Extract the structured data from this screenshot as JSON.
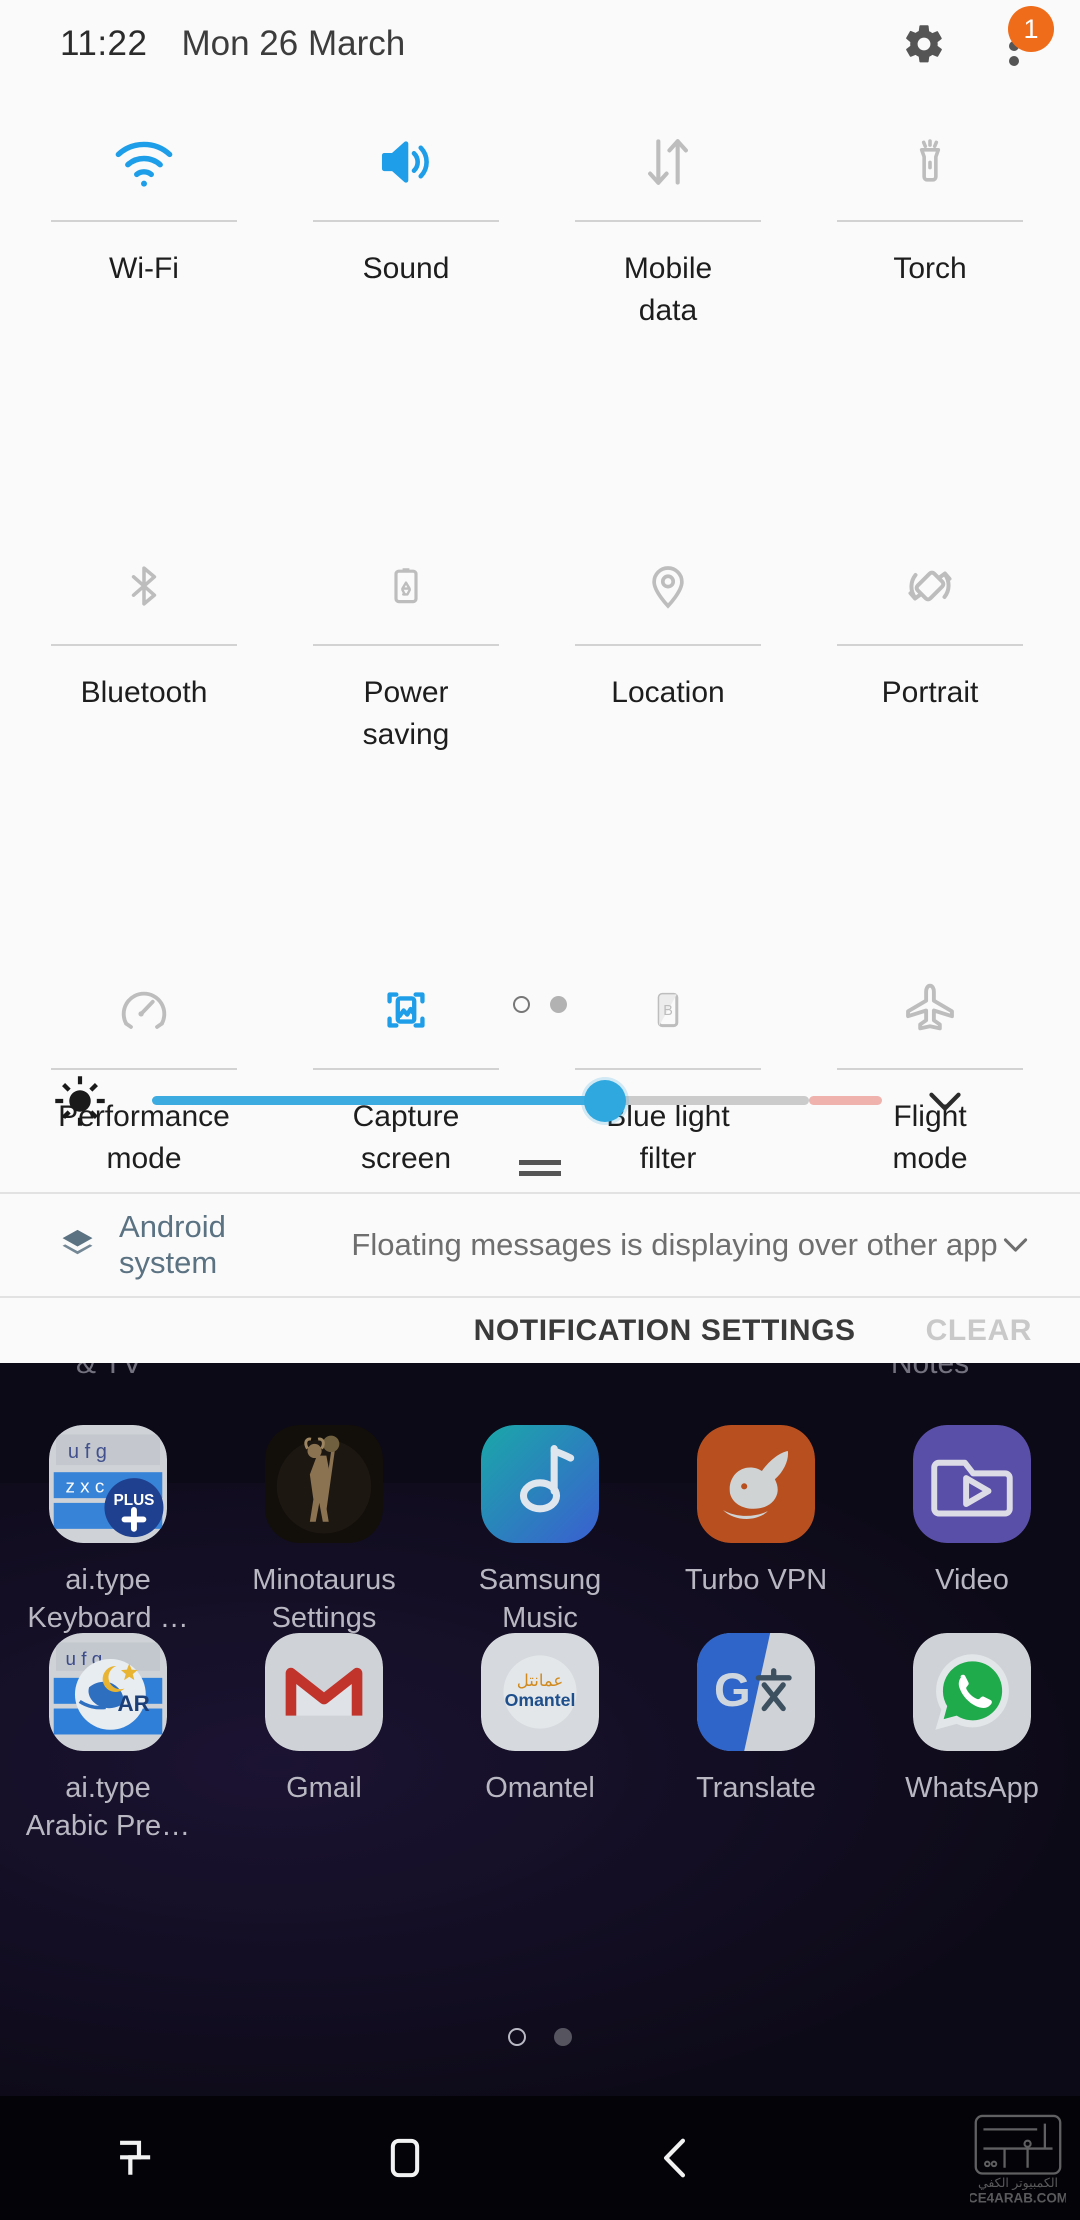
{
  "status_bar": {
    "time": "11:22",
    "date": "Mon 26 March",
    "settings_icon": "gear-icon",
    "overflow_icon": "overflow-menu-icon",
    "badge_count": "1",
    "badge_color": "#ef6c1a"
  },
  "quick_settings": {
    "accent_color": "#1e9ee8",
    "inactive_color": "#bdbdbd",
    "tiles": [
      {
        "label": "Wi-Fi",
        "icon": "wifi-icon",
        "active": true
      },
      {
        "label": "Sound",
        "icon": "sound-icon",
        "active": true
      },
      {
        "label": "Mobile\ndata",
        "icon": "mobile-data-icon",
        "active": false
      },
      {
        "label": "Torch",
        "icon": "torch-icon",
        "active": false
      },
      {
        "label": "Bluetooth",
        "icon": "bluetooth-icon",
        "active": false
      },
      {
        "label": "Power\nsaving",
        "icon": "power-saving-icon",
        "active": false
      },
      {
        "label": "Location",
        "icon": "location-icon",
        "active": false
      },
      {
        "label": "Portrait",
        "icon": "rotation-icon",
        "active": false
      },
      {
        "label": "Performance\nmode",
        "icon": "performance-icon",
        "active": false
      },
      {
        "label": "Capture\nscreen",
        "icon": "capture-icon",
        "active": true
      },
      {
        "label": "Blue light\nfilter",
        "icon": "blue-light-icon",
        "active": false
      },
      {
        "label": "Flight\nmode",
        "icon": "flight-mode-icon",
        "active": false
      }
    ],
    "page_dots": {
      "count": 2,
      "current": 1
    }
  },
  "brightness": {
    "icon": "brightness-icon",
    "value_percent": 62,
    "track_blue": "#3cabe0",
    "track_grey": "#cbcbcb",
    "track_pink": "#f0b2ad",
    "expand_icon": "chevron-down-icon"
  },
  "notification": {
    "icon": "android-system-icon",
    "app": "Android system",
    "text": "Floating messages is displaying over other apps",
    "expand_icon": "chevron-down-icon"
  },
  "actions": {
    "settings_label": "NOTIFICATION SETTINGS",
    "clear_label": "CLEAR"
  },
  "drawer": {
    "cut_label_left": "& TV",
    "cut_label_right": "Notes",
    "rows": [
      [
        {
          "label": "ai.type\nKeyboard …",
          "icon": "aitype-keyboard-icon"
        },
        {
          "label": "Minotaurus\nSettings",
          "icon": "minotaurus-icon"
        },
        {
          "label": "Samsung\nMusic",
          "icon": "samsung-music-icon"
        },
        {
          "label": "Turbo VPN",
          "icon": "turbo-vpn-icon"
        },
        {
          "label": "Video",
          "icon": "video-icon"
        }
      ],
      [
        {
          "label": "ai.type\nArabic Pre…",
          "icon": "aitype-arabic-icon"
        },
        {
          "label": "Gmail",
          "icon": "gmail-icon"
        },
        {
          "label": "Omantel",
          "icon": "omantel-icon"
        },
        {
          "label": "Translate",
          "icon": "translate-icon"
        },
        {
          "label": "WhatsApp",
          "icon": "whatsapp-icon"
        }
      ]
    ],
    "page_dots": {
      "count": 2,
      "current": 1
    }
  },
  "navbar": {
    "recents_icon": "recents-icon",
    "home_icon": "home-icon",
    "back_icon": "back-icon",
    "watermark": "CE4ARAB.COM",
    "watermark_arabic": "الكمبيوتر الكفي"
  }
}
